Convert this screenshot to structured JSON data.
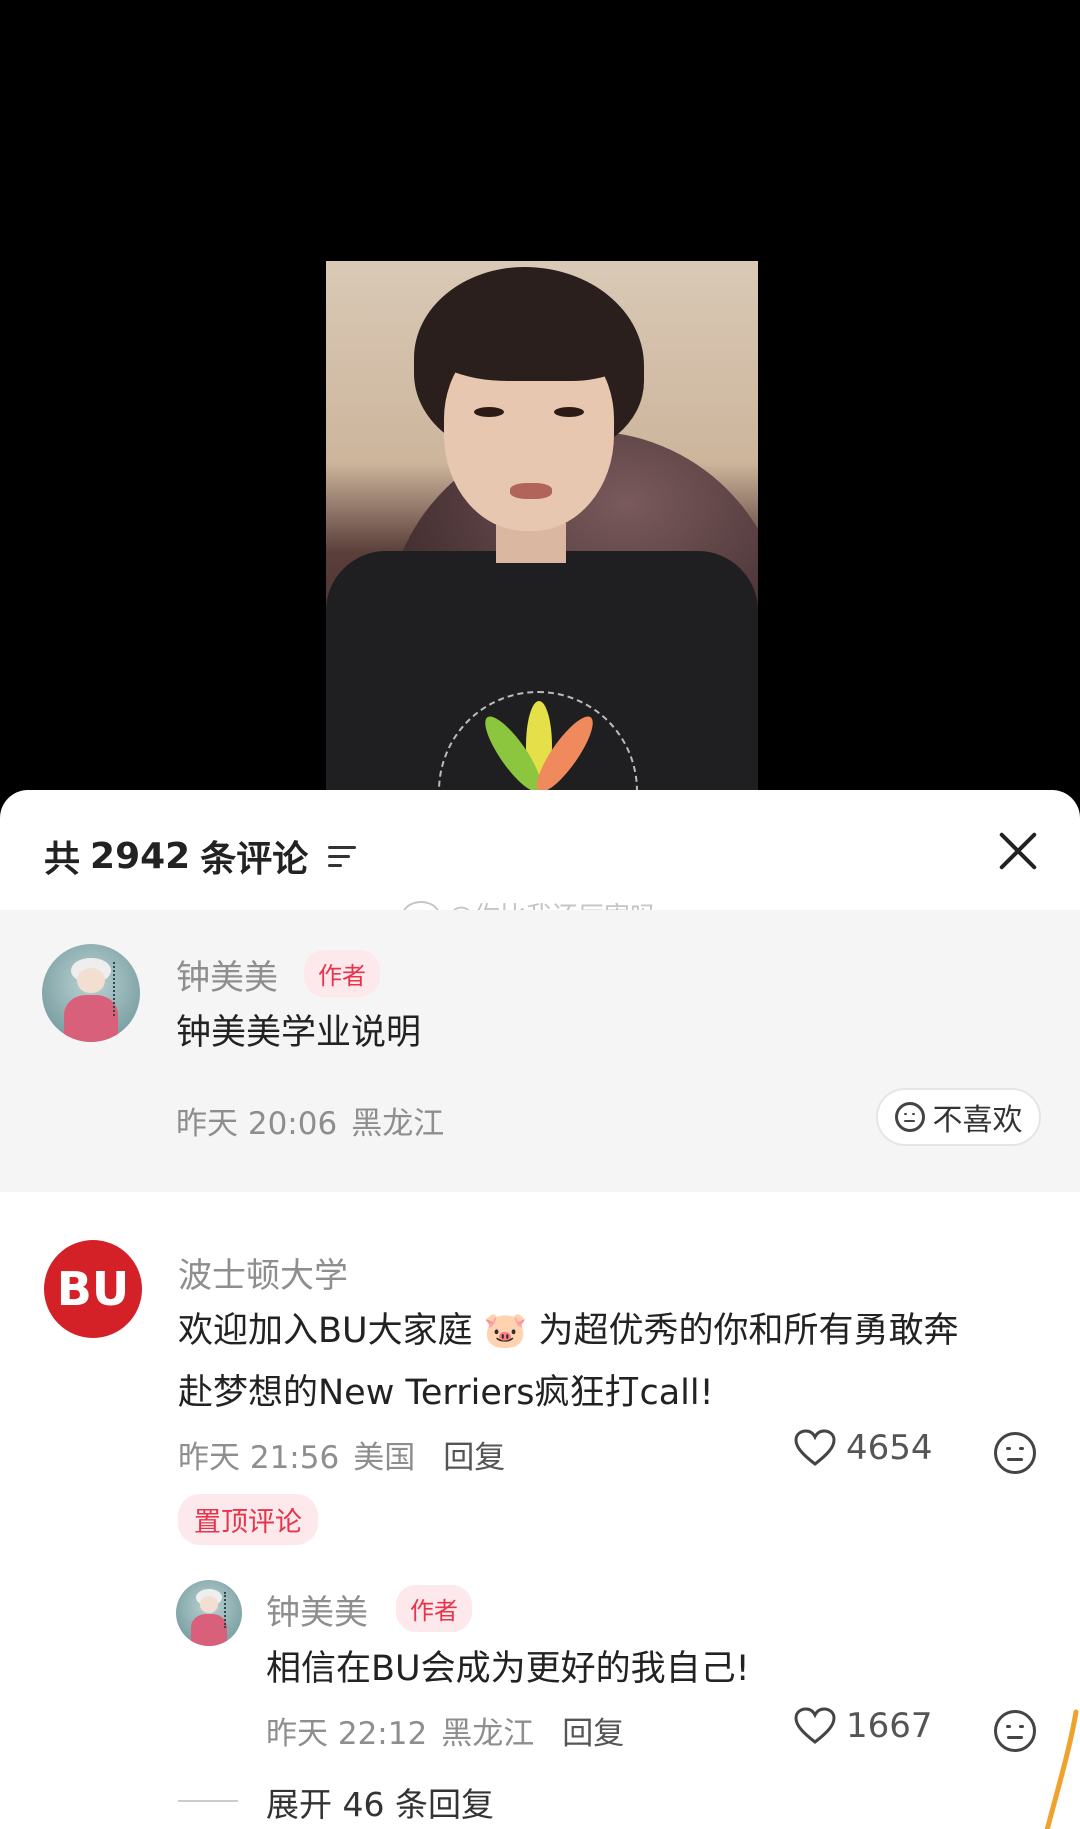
{
  "header": {
    "count_prefix": "共",
    "count": "2942",
    "count_suffix": "条评论",
    "sort_icon": "sort-lines-icon",
    "close_icon": "close-icon"
  },
  "watermark": "@你比我还厉害吗",
  "pinned_author_comment": {
    "username": "钟美美",
    "tag": "作者",
    "text": "钟美美学业说明",
    "time": "昨天 20:06",
    "location": "黑龙江",
    "dislike_label": "不喜欢"
  },
  "comment": {
    "username": "波士顿大学",
    "avatar_text": "BU",
    "text_line1": "欢迎加入BU大家庭 🐷 为超优秀的你和所有勇敢奔",
    "text_line2": "赴梦想的New Terriers疯狂打call!",
    "time": "昨天 21:56",
    "location": "美国",
    "reply_label": "回复",
    "likes": "4654",
    "pinned_label": "置顶评论"
  },
  "reply": {
    "username": "钟美美",
    "tag": "作者",
    "text": "相信在BU会成为更好的我自己!",
    "time": "昨天 22:12",
    "location": "黑龙江",
    "reply_label": "回复",
    "likes": "1667"
  },
  "expand": "展开 46 条回复",
  "colors": {
    "accent": "#e8344a",
    "bu_red": "#d42027",
    "muted": "#8e8e8e"
  }
}
